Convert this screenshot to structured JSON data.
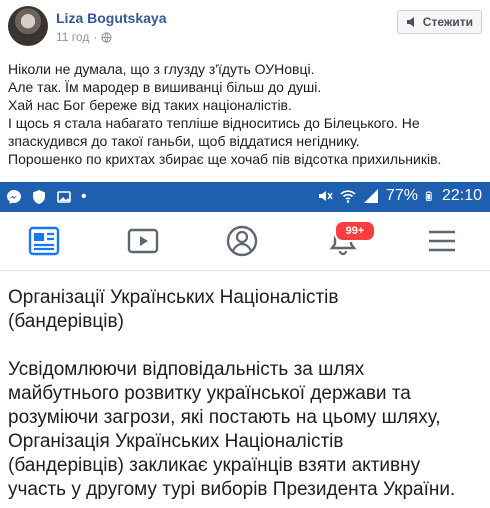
{
  "post": {
    "author": "Liza Bogutskaya",
    "time": "11 год",
    "follow_label": "Стежити",
    "text_lines": [
      "Ніколи не думала, що з глузду з'їдуть ОУНовці.",
      "Але так. Їм мародер в вишиванці більш до душі.",
      "Хай нас Бог береже від таких націоналістів.",
      "І щось я стала набагато тепліше відноситись до Білецького. Не",
      "зпаскудився до такої ганьби, щоб віддатися негіднику.",
      "Порошенко по крихтах збирає ще хочаб пів відсотка прихильників."
    ]
  },
  "screenshot": {
    "status": {
      "battery": "77%",
      "time": "22:10"
    },
    "badge": "99+",
    "doc_title_lines": [
      "Організації Українських Націоналістів",
      "(бандерівців)"
    ],
    "doc_body_lines": [
      "Усвідомлюючи відповідальність за шлях",
      "майбутнього розвитку української держави та",
      "розуміючи загрози, які постають на цьому шляху,",
      "Організація Українських Націоналістів",
      "(бандерівців) закликає українців взяти активну",
      "участь у другому турі виборів Президента України."
    ]
  },
  "colors": {
    "link": "#365899",
    "statusbar": "#1f5fb0",
    "badge": "#fa3e3e",
    "icon": "#4f7fbf"
  },
  "icons": [
    "globe-icon",
    "follow-icon",
    "messenger-icon",
    "shield-icon",
    "image-icon",
    "mute-icon",
    "wifi-icon",
    "signal-icon",
    "battery-icon",
    "news-feed-icon",
    "video-icon",
    "profile-icon",
    "bell-icon",
    "menu-icon"
  ]
}
